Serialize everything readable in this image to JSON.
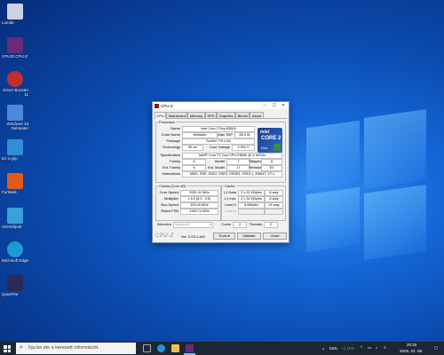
{
  "desktop": {
    "icons": [
      {
        "label": "Lomtár",
        "color": "#c9d4e0"
      },
      {
        "label": "CPUID CPU-Z",
        "color": "#6a2a7a"
      },
      {
        "label": "Driver Booster 11",
        "color": "#c0302a"
      },
      {
        "label": "Windows 10 Debloater",
        "color": "#4a8ad8"
      },
      {
        "label": "Ez a gép",
        "color": "#2d8fd8"
      },
      {
        "label": "FurMark",
        "color": "#e05a1a"
      },
      {
        "label": "Vezérlőpult",
        "color": "#3aa0d8"
      },
      {
        "label": "Microsoft Edge",
        "color": "#1c9ad6"
      },
      {
        "label": "QuickPar",
        "color": "#2a2a5a"
      }
    ]
  },
  "window": {
    "title": "CPU-Z",
    "tabs": [
      "CPU",
      "Mainboard",
      "Memory",
      "SPD",
      "Graphics",
      "Bench",
      "About"
    ],
    "active_tab": "CPU",
    "processor": {
      "group_label": "Processor",
      "name_label": "Name",
      "name": "Intel Core 2 Duo E8500",
      "codename_label": "Code Name",
      "codename": "Wolfdale",
      "maxtdp_label": "Max TDP",
      "maxtdp": "65.0 W",
      "package_label": "Package",
      "package": "Socket 775 LGA",
      "technology_label": "Technology",
      "technology": "45 nm",
      "voltage_label": "Core Voltage",
      "voltage": "0.904 V",
      "spec_label": "Specification",
      "spec": "Intel® Core™2 Duo CPU     E8500  @ 3.16GHz",
      "family_label": "Family",
      "family": "6",
      "model_label": "Model",
      "model": "7",
      "stepping_label": "Stepping",
      "stepping": "A",
      "extfamily_label": "Ext. Family",
      "extfamily": "6",
      "extmodel_label": "Ext. Model",
      "extmodel": "17",
      "revision_label": "Revision",
      "revision": "E0",
      "instructions_label": "Instructions",
      "instructions": "MMX, SSE, SSE2, SSE3, SSSE3, SSE4.1, EM64T, VT-x",
      "logo_top": "intel",
      "logo_main": "CORE 2",
      "logo_sub": "Duo"
    },
    "clocks": {
      "group_label": "Clocks (Core #0)",
      "speed_label": "Core Speed",
      "speed": "2000.41 MHz",
      "mult_label": "Multiplier",
      "mult": "x 6.0 (6.0 - 9.5)",
      "bus_label": "Bus Speed",
      "bus": "333.40 MHz",
      "fsb_label": "Rated FSB",
      "fsb": "1333.74 MHz"
    },
    "cache": {
      "group_label": "Cache",
      "l1d_label": "L1 Data",
      "l1d": "2 x 32 KBytes",
      "l1d_way": "8-way",
      "l1i_label": "L1 Inst.",
      "l1i": "2 x 32 KBytes",
      "l1i_way": "8-way",
      "l2_label": "Level 2",
      "l2": "6 MBytes",
      "l2_way": "24-way",
      "l3_label": "Level 3"
    },
    "footer": {
      "selection_label": "Selection",
      "selection": "Socket #1",
      "cores_label": "Cores",
      "cores": "2",
      "threads_label": "Threads",
      "threads": "2",
      "logo": "CPU-Z",
      "version": "Ver. 2.03.1.x64",
      "tools": "Tools",
      "validate": "Validate",
      "close": "Close"
    }
  },
  "taskbar": {
    "search_placeholder": "Írja be ide a keresett információt.",
    "stock_name": "MOL",
    "stock_change": "+1,11%",
    "time": "20:30",
    "date": "2025. 02. 06."
  }
}
